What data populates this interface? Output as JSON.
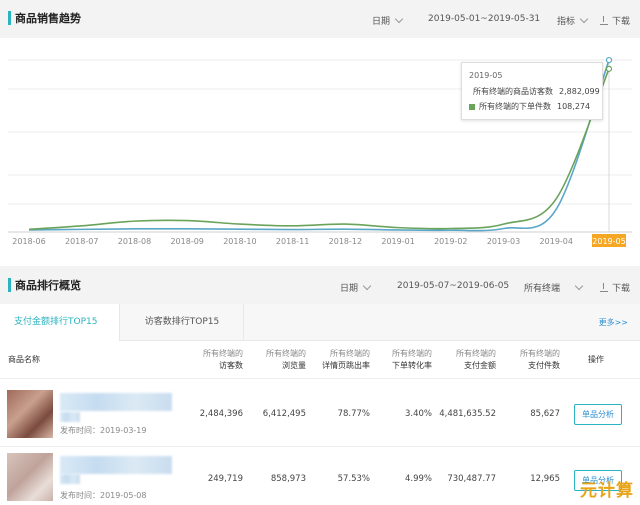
{
  "sales_trend": {
    "title": "商品销售趋势",
    "date_label": "日期",
    "date_range": "2019-05-01~2019-05-31",
    "metric_label": "指标",
    "download_label": "下载",
    "tooltip": {
      "date": "2019-05",
      "rows": [
        {
          "label": "所有终端的商品访客数",
          "value": "2,882,099",
          "color": "#5aa7c8"
        },
        {
          "label": "所有终端的下单件数",
          "value": "108,274",
          "color": "#6aa35a"
        }
      ]
    }
  },
  "chart_data": {
    "type": "line",
    "categories": [
      "2018-06",
      "2018-07",
      "2018-08",
      "2018-09",
      "2018-10",
      "2018-11",
      "2018-12",
      "2019-01",
      "2019-02",
      "2019-03",
      "2019-04",
      "2019-05"
    ],
    "highlighted_category": "2019-05",
    "grid": true,
    "series": [
      {
        "name": "所有终端的商品访客数",
        "color": "#5aa7c8",
        "values": [
          0.012,
          0.015,
          0.018,
          0.018,
          0.016,
          0.014,
          0.016,
          0.012,
          0.01,
          0.02,
          0.13,
          0.98
        ]
      },
      {
        "name": "所有终端的下单件数",
        "color": "#6aa35a",
        "values": [
          0.015,
          0.035,
          0.062,
          0.065,
          0.045,
          0.035,
          0.045,
          0.025,
          0.02,
          0.045,
          0.19,
          0.93
        ]
      }
    ]
  },
  "ranking": {
    "title": "商品排行概览",
    "date_label": "日期",
    "date_range": "2019-05-07~2019-06-05",
    "terminal_label": "所有终端",
    "download_label": "下载",
    "tabs": [
      "支付金额排行TOP15",
      "访客数排行TOP15"
    ],
    "more_label": "更多>>",
    "columns": {
      "name": "商品名称",
      "visitors": [
        "所有终端的",
        "访客数"
      ],
      "pageviews": [
        "所有终端的",
        "浏览量"
      ],
      "bounce": [
        "所有终端的",
        "详情页跳出率"
      ],
      "conversion": [
        "所有终端的",
        "下单转化率"
      ],
      "amount": [
        "所有终端的",
        "支付金额"
      ],
      "pieces": [
        "所有终端的",
        "支付件数"
      ],
      "action": "操作"
    },
    "rows": [
      {
        "publish": "发布时间：2019-03-19",
        "visitors": "2,484,396",
        "pageviews": "6,412,495",
        "bounce": "78.77%",
        "conversion": "3.40%",
        "amount": "4,481,635.52",
        "pieces": "85,627",
        "action": "单品分析"
      },
      {
        "publish": "发布时间：2019-05-08",
        "visitors": "249,719",
        "pageviews": "858,973",
        "bounce": "57.53%",
        "conversion": "4.99%",
        "amount": "730,487.77",
        "pieces": "12,965",
        "action": "单品分析"
      }
    ]
  },
  "watermark": "元计算"
}
